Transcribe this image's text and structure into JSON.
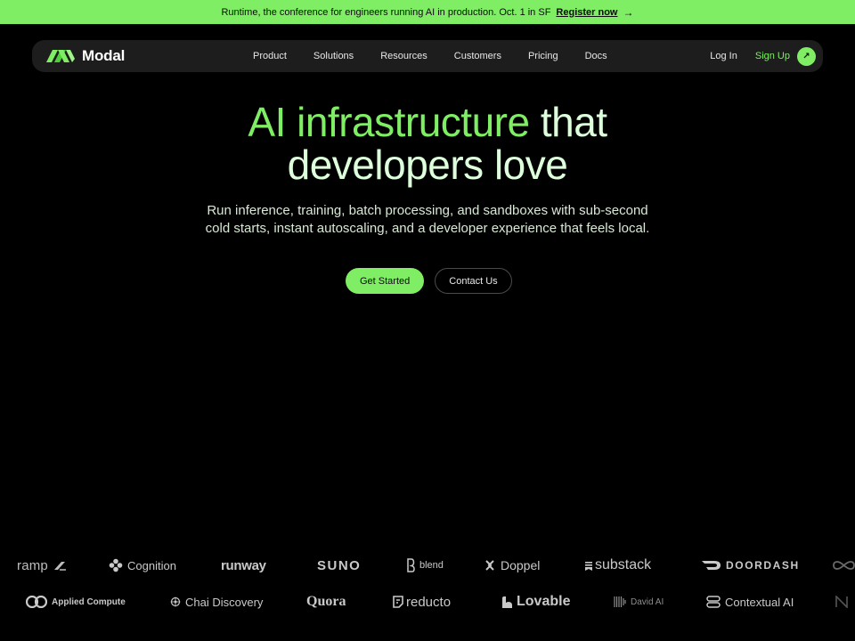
{
  "banner": {
    "text": "Runtime, the conference for engineers running AI in production. Oct. 1 in SF",
    "link": "Register now",
    "arrow": "→"
  },
  "nav": {
    "brand": "Modal",
    "links": [
      "Product",
      "Solutions",
      "Resources",
      "Customers",
      "Pricing",
      "Docs"
    ],
    "login": "Log In",
    "signup": "Sign Up",
    "signup_icon": "↗"
  },
  "hero": {
    "title_accent": "AI infrastructure",
    "title_rest_line1": " that",
    "title_line2": "developers love",
    "subtitle": "Run inference, training, batch processing, and sandboxes with sub-second cold starts, instant autoscaling, and a developer experience that feels local.",
    "cta_primary": "Get Started",
    "cta_secondary": "Contact Us"
  },
  "colors": {
    "accent": "#7fee64",
    "nav_bg": "#1c1d1c",
    "page_bg": "#000000",
    "title": "#ddffdc"
  },
  "customers": {
    "row1": [
      "ramp",
      "Cognition",
      "runway",
      "SUNO",
      "blend",
      "Doppel",
      "substack",
      "DOORDASH"
    ],
    "row2": [
      "Applied Compute",
      "Chai Discovery",
      "Quora",
      "reducto",
      "Lovable",
      "David AI",
      "Contextual AI"
    ]
  }
}
